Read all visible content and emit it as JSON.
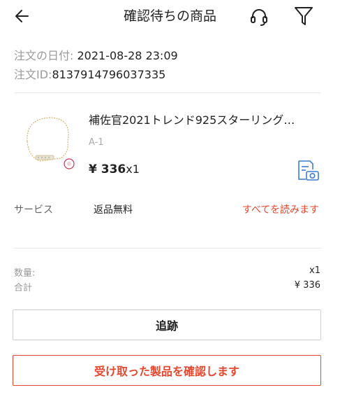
{
  "header": {
    "title": "確認待ちの商品",
    "icons": {
      "back": "back-arrow-icon",
      "support": "headset-icon",
      "filter": "filter-icon"
    }
  },
  "order": {
    "date_label": "注文の日付:",
    "date_value": " 2021-08-28 23:09",
    "id_label": "注文ID:",
    "id_value": "8137914796037335"
  },
  "product": {
    "name": "補佐官2021トレンド925スターリング…",
    "sku": "A-1",
    "price": "¥ 336",
    "qty": "x1",
    "review_icon": "photo-review-icon"
  },
  "service": {
    "label": "サービス",
    "value": "返品無料",
    "link": "すべてを読みます"
  },
  "summary": {
    "qty_label": "数量:",
    "qty_value": "x1",
    "total_label": "合計",
    "total_value": "¥ 336"
  },
  "actions": {
    "track_label": "追跡",
    "confirm_label": "受け取った製品を確認します"
  },
  "colors": {
    "accent": "#e5482f",
    "text": "#222222",
    "muted": "#999999"
  }
}
